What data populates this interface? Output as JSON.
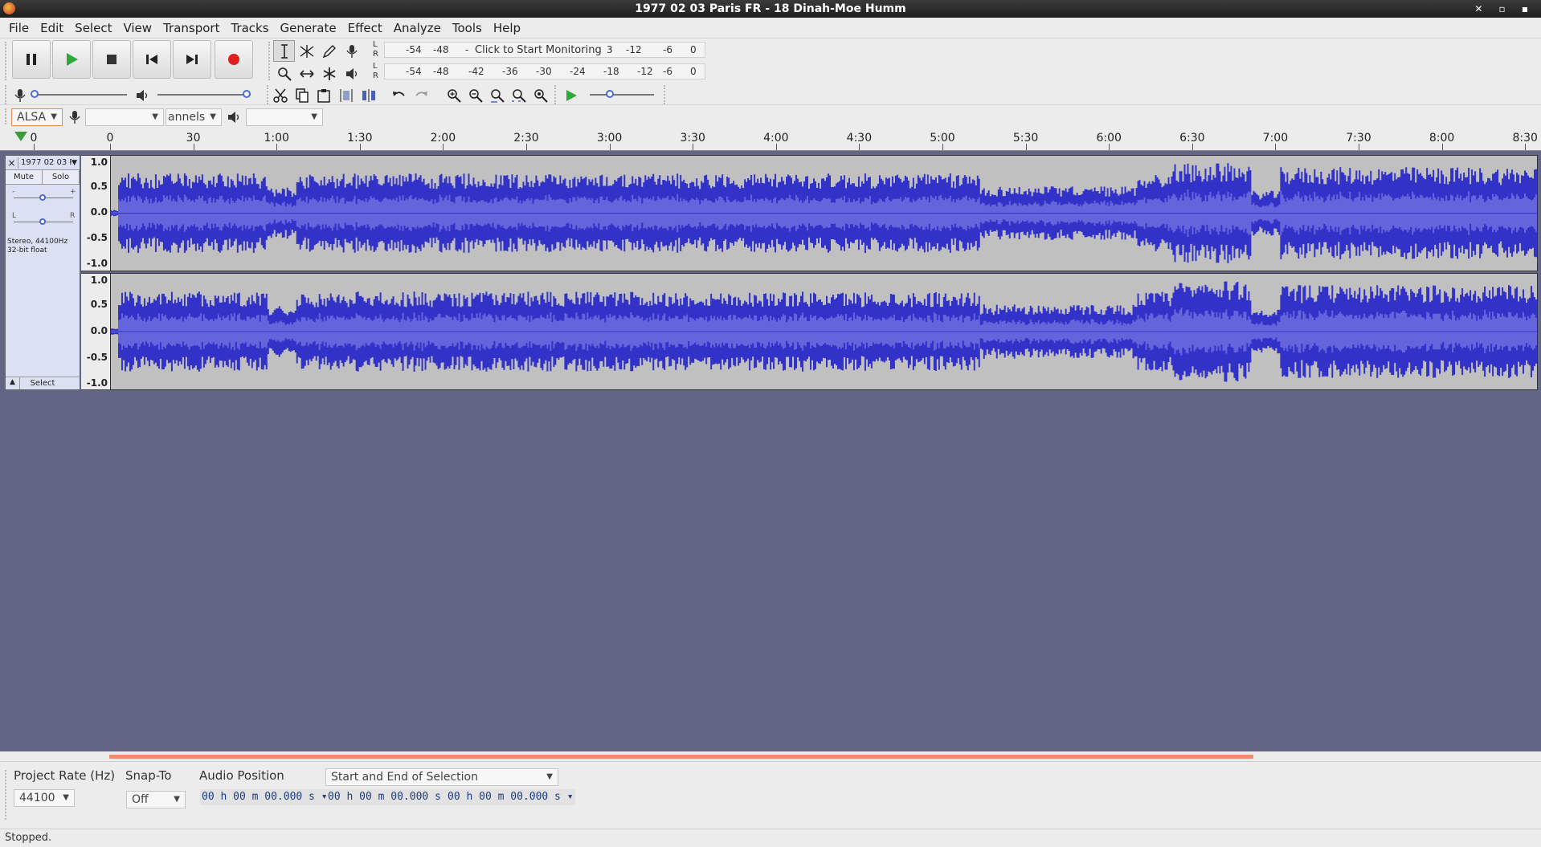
{
  "window": {
    "title": "1977 02 03 Paris FR - 18 Dinah-Moe Humm"
  },
  "menu": [
    "File",
    "Edit",
    "Select",
    "View",
    "Transport",
    "Tracks",
    "Generate",
    "Effect",
    "Analyze",
    "Tools",
    "Help"
  ],
  "meters": {
    "record_ticks": [
      "-54",
      "-48",
      "-",
      "3",
      "-12",
      "-6",
      "0"
    ],
    "monitor_text": "Click to Start Monitoring",
    "play_ticks": [
      "-54",
      "-48",
      "-42",
      "-36",
      "-30",
      "-24",
      "-18",
      "-12",
      "-6",
      "0"
    ],
    "lr": "L R"
  },
  "device": {
    "host": "ALSA",
    "channels": "annels"
  },
  "timeline": {
    "labels": [
      "0",
      "0",
      "30",
      "1:00",
      "1:30",
      "2:00",
      "2:30",
      "3:00",
      "3:30",
      "4:00",
      "4:30",
      "5:00",
      "5:30",
      "6:00",
      "6:30",
      "7:00",
      "7:30",
      "8:00",
      "8:30"
    ]
  },
  "track": {
    "name": "1977 02 03 P",
    "mute": "Mute",
    "solo": "Solo",
    "gain_minus": "-",
    "gain_plus": "+",
    "pan_left": "L",
    "pan_right": "R",
    "info_line1": "Stereo, 44100Hz",
    "info_line2": "32-bit float",
    "select": "Select",
    "close": "×",
    "collapse": "▲",
    "ruler": [
      "1.0",
      "0.5",
      "0.0",
      "-0.5",
      "-1.0"
    ]
  },
  "colors": {
    "wave": "#3232c8",
    "wave_rms": "#6464dc",
    "wave_bg": "#c0c0c0",
    "track_bg": "#636584",
    "selection_strip": "#f08c6b"
  },
  "selection_toolbar": {
    "project_rate_label": "Project Rate (Hz)",
    "project_rate_value": "44100",
    "snap_to_label": "Snap-To",
    "snap_to_value": "Off",
    "audio_position_label": "Audio Position",
    "selection_mode": "Start and End of Selection",
    "audio_position": "00 h 00 m 00.000 s",
    "sel_start": "00 h 00 m 00.000 s",
    "sel_end": "00 h 00 m 00.000 s"
  },
  "status": "Stopped."
}
